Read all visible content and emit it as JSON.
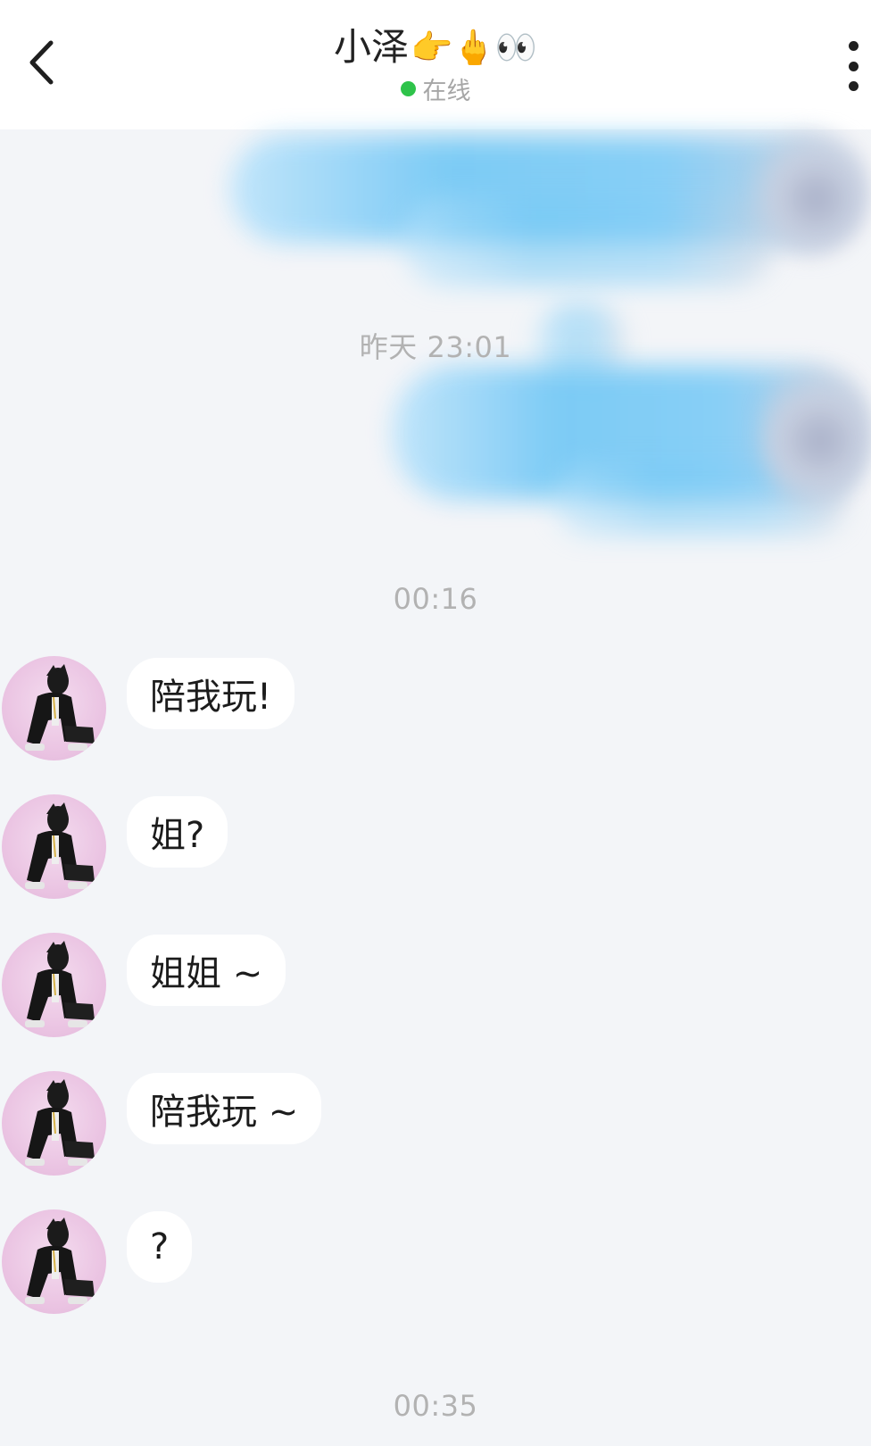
{
  "header": {
    "title": "小泽",
    "title_emojis": "👉🖕👀",
    "status": "在线",
    "status_color": "#2ec34a"
  },
  "timestamps": {
    "t1": "昨天 23:01",
    "t2": "00:16",
    "t3": "00:35"
  },
  "messages": [
    {
      "text": "陪我玩!"
    },
    {
      "text": "姐?"
    },
    {
      "text": "姐姐 ~"
    },
    {
      "text": "陪我玩 ~"
    },
    {
      "text": "?"
    }
  ],
  "icons": {
    "back": "chevron-left-icon",
    "more": "vertical-dots-icon"
  },
  "colors": {
    "background": "#f3f5f8",
    "bubble": "#ffffff",
    "outgoing_redacted": "#76c9f5"
  }
}
